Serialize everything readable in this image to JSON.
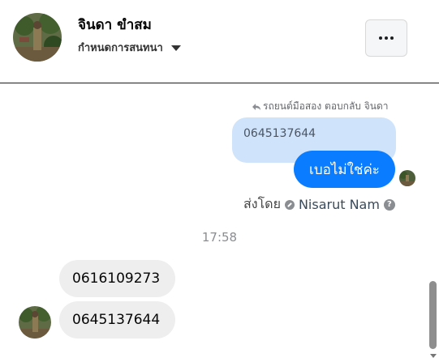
{
  "header": {
    "contact_name": "จินดา ขำสม",
    "subtitle": "กำหนดการสนทนา",
    "more_button_label": "More options"
  },
  "thread": {
    "reply_label": "รถยนต์มือสอง ตอบกลับ จินดา",
    "replied_message": "0645137644",
    "outgoing_message": "เบอไม่ใช่ค่ะ",
    "sent_by_label": "ส่งโดย",
    "sent_by_name": "Nisarut Nam",
    "timestamp": "17:58",
    "incoming_messages": [
      "0616109273",
      "0645137644"
    ]
  },
  "colors": {
    "outgoing_bubble": "#0a7cff",
    "reply_bubble": "#cfe3fb",
    "incoming_bubble": "#eeeeee"
  },
  "icons": {
    "reply": "reply-arrow-icon",
    "more": "more-dots-icon",
    "dropdown": "caret-down-icon",
    "sent_by": "sent-by-circle-icon",
    "help": "help-icon"
  }
}
